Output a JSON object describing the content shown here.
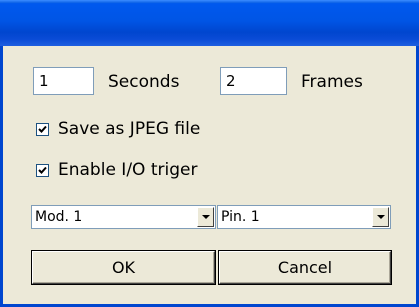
{
  "window": {
    "title": ""
  },
  "timing": {
    "seconds_value": "1",
    "seconds_label": "Seconds",
    "frames_value": "2",
    "frames_label": "Frames"
  },
  "options": {
    "save_jpeg_label": "Save as JPEG file",
    "save_jpeg_checked": true,
    "io_trigger_label": "Enable I/O triger",
    "io_trigger_checked": true
  },
  "selectors": {
    "module_value": "Mod. 1",
    "pin_value": "Pin. 1"
  },
  "buttons": {
    "ok_label": "OK",
    "cancel_label": "Cancel"
  },
  "colors": {
    "titlebar": "#0055e5",
    "dialog_background": "#ece9d8"
  }
}
